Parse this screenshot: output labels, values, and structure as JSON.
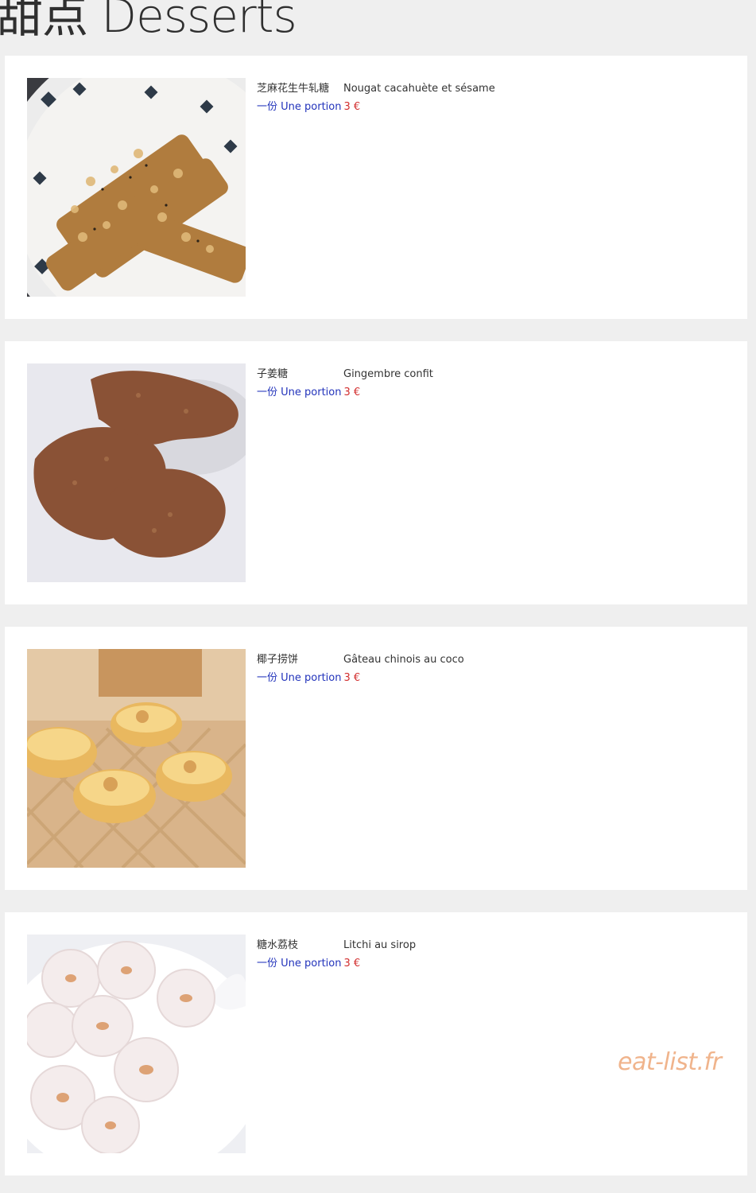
{
  "page": {
    "title": "甜点 Desserts"
  },
  "items": [
    {
      "name_zh": "芝麻花生牛轧糖",
      "name_fr": "Nougat cacahuète et sésame",
      "portion": "一份 Une portion",
      "price": "3 €",
      "image": "peanut-sesame-nougat-photo"
    },
    {
      "name_zh": "子姜糖",
      "name_fr": "Gingembre confit",
      "portion": "一份 Une portion",
      "price": "3 €",
      "image": "candied-ginger-photo"
    },
    {
      "name_zh": "椰子捞饼",
      "name_fr": "Gâteau chinois au coco",
      "portion": "一份 Une portion",
      "price": "3 €",
      "image": "coconut-cake-photo"
    },
    {
      "name_zh": "糖水荔枝",
      "name_fr": "Litchi au sirop",
      "portion": "一份 Une portion",
      "price": "3 €",
      "image": "lychee-syrup-photo"
    }
  ],
  "watermark": "eat-list.fr",
  "colors": {
    "portion": "#2233bb",
    "price": "#d22d2d",
    "background": "#efefef",
    "card": "#ffffff"
  }
}
